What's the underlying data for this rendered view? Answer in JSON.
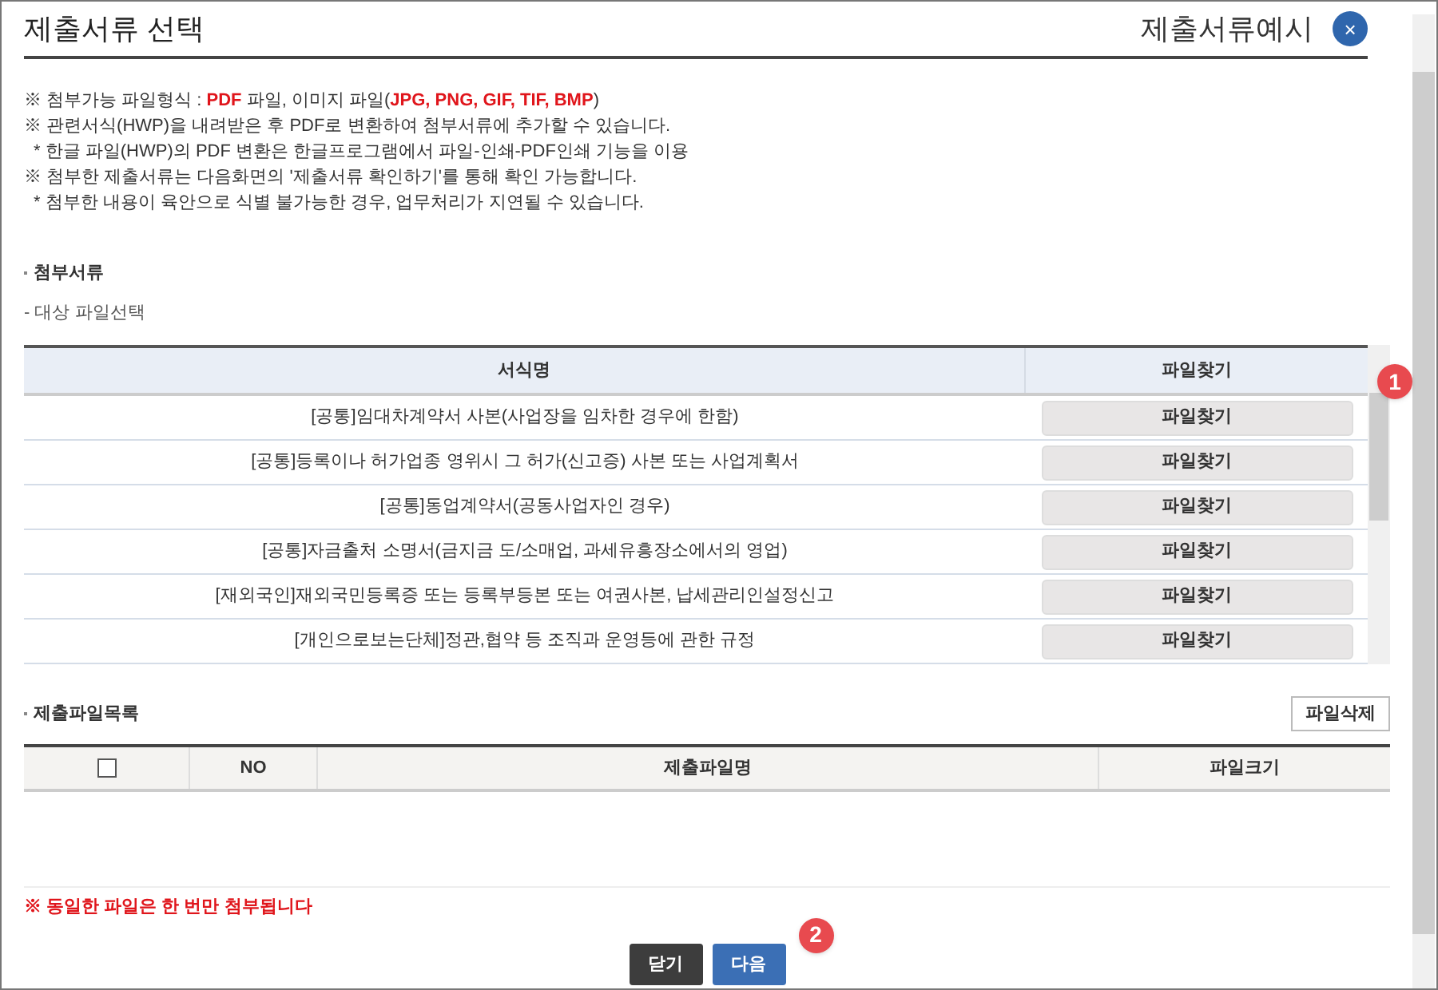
{
  "title": "제출서류 선택",
  "example_link": "제출서류예시",
  "close": "×",
  "notices": [
    {
      "kind": "main",
      "parts": [
        {
          "text": "※ 첨부가능 파일형식 : ",
          "red": false
        },
        {
          "text": "PDF",
          "red": true
        },
        {
          "text": " 파일, 이미지 파일(",
          "red": false
        },
        {
          "text": "JPG, PNG, GIF, TIF, BMP",
          "red": true
        },
        {
          "text": ")",
          "red": false
        }
      ]
    },
    {
      "kind": "main",
      "parts": [
        {
          "text": "※ 관련서식(HWP)을 내려받은 후 PDF로 변환하여 첨부서류에 추가할 수 있습니다.",
          "red": false
        }
      ]
    },
    {
      "kind": "sub",
      "parts": [
        {
          "text": "* 한글 파일(HWP)의 PDF 변환은 한글프로그램에서 파일-인쇄-PDF인쇄 기능을 이용",
          "red": false
        }
      ]
    },
    {
      "kind": "main",
      "parts": [
        {
          "text": "※ 첨부한 제출서류는 다음화면의 '제출서류 확인하기'를 통해 확인 가능합니다.",
          "red": false
        }
      ]
    },
    {
      "kind": "sub",
      "parts": [
        {
          "text": "* 첨부한 내용이 육안으로 식별 불가능한 경우, 업무처리가 지연될 수 있습니다.",
          "red": false
        }
      ]
    }
  ],
  "attach_section": {
    "title": "첨부서류",
    "subtitle": "- 대상 파일선택",
    "columns": [
      "서식명",
      "파일찾기"
    ],
    "rows": [
      {
        "name": "[공통]임대차계약서 사본(사업장을 임차한 경우에 한함)",
        "button": "파일찾기"
      },
      {
        "name": "[공통]등록이나 허가업종 영위시 그 허가(신고증) 사본 또는 사업계획서",
        "button": "파일찾기"
      },
      {
        "name": "[공통]동업계약서(공동사업자인 경우)",
        "button": "파일찾기"
      },
      {
        "name": "[공통]자금출처 소명서(금지금 도/소매업, 과세유흥장소에서의 영업)",
        "button": "파일찾기"
      },
      {
        "name": "[재외국인]재외국민등록증 또는 등록부등본 또는 여권사본, 납세관리인설정신고",
        "button": "파일찾기"
      },
      {
        "name": "[개인으로보는단체]정관,협약 등 조직과 운영등에 관한 규정",
        "button": "파일찾기"
      }
    ]
  },
  "files_section": {
    "title": "제출파일목록",
    "delete_button": "파일삭제",
    "select_all": {
      "checked": false
    },
    "columns": [
      "NO",
      "제출파일명",
      "파일크기"
    ]
  },
  "warning": "※ 동일한 파일은 한 번만 첨부됩니다",
  "buttons": [
    {
      "label": "닫기",
      "kind": "dark"
    },
    {
      "label": "다음",
      "kind": "primary"
    }
  ],
  "callouts": [
    "1",
    "2"
  ]
}
